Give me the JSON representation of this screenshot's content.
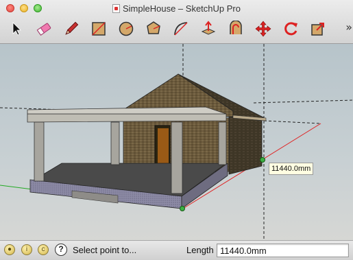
{
  "window": {
    "title": "SimpleHouse – SketchUp Pro"
  },
  "toolbar": {
    "tools": [
      {
        "name": "select",
        "icon": "arrow-cursor-icon"
      },
      {
        "name": "eraser",
        "icon": "eraser-icon"
      },
      {
        "name": "line",
        "icon": "pencil-icon"
      },
      {
        "name": "rectangle",
        "icon": "rectangle-icon"
      },
      {
        "name": "circle",
        "icon": "circle-icon"
      },
      {
        "name": "polygon",
        "icon": "polygon-icon"
      },
      {
        "name": "arc",
        "icon": "arc-icon"
      },
      {
        "name": "push-pull",
        "icon": "push-pull-icon"
      },
      {
        "name": "offset",
        "icon": "offset-icon"
      },
      {
        "name": "move",
        "icon": "move-icon"
      },
      {
        "name": "rotate",
        "icon": "rotate-icon"
      },
      {
        "name": "scale",
        "icon": "scale-icon"
      }
    ],
    "overflow_label": "»"
  },
  "viewport": {
    "tooltip": "11440.0mm",
    "colors": {
      "red_axis": "#e02020",
      "green_axis": "#22aa22",
      "blue_axis": "#2020d0",
      "brick": "#6b5a3c",
      "floor": "#4a4a4a",
      "column": "#a7a59e",
      "endpoint": "#3cb043"
    }
  },
  "status": {
    "icons": [
      "geo-location-icon",
      "credits-icon",
      "status-info-icon"
    ],
    "help_glyph": "?",
    "message": "Select point to...",
    "length_label": "Length",
    "length_value": "11440.0mm"
  }
}
